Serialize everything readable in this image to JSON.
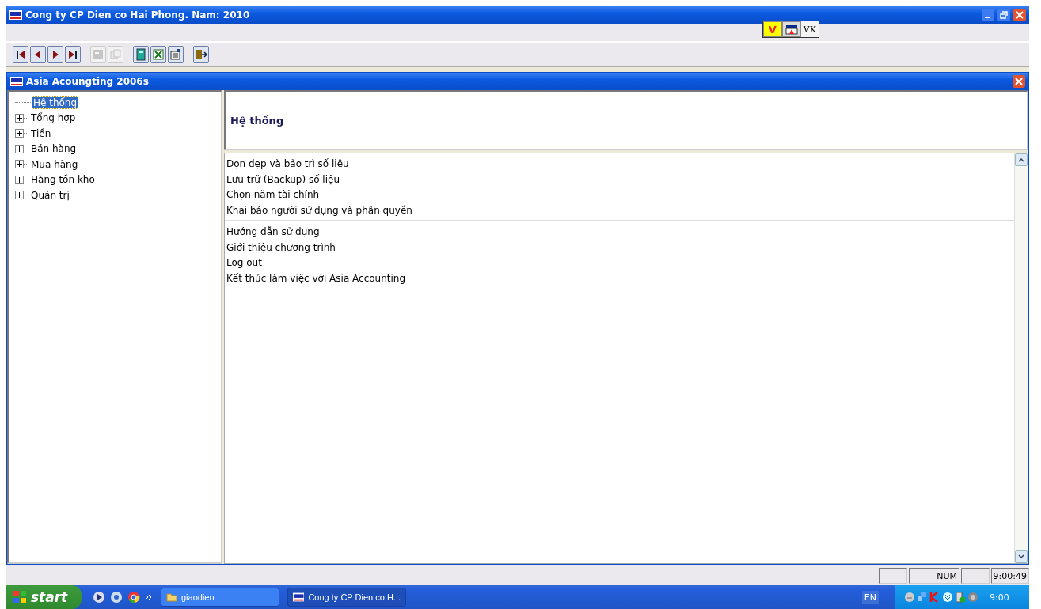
{
  "window": {
    "title": "Cong ty CP Dien co Hai Phong. Nam: 2010",
    "vk_label": "VK",
    "v_label": "V"
  },
  "toolbar": [
    {
      "kind": "first",
      "disabled": false
    },
    {
      "kind": "prev",
      "disabled": false
    },
    {
      "kind": "next",
      "disabled": false
    },
    {
      "kind": "last",
      "disabled": false
    },
    {
      "kind": "note",
      "disabled": true
    },
    {
      "kind": "copy",
      "disabled": true
    },
    {
      "kind": "calc",
      "disabled": false
    },
    {
      "kind": "excel",
      "disabled": false
    },
    {
      "kind": "form",
      "disabled": false
    },
    {
      "kind": "exit",
      "disabled": false
    }
  ],
  "child_window": {
    "title": "Asia Acoungting 2006s"
  },
  "tree": [
    {
      "label": "Hệ thống",
      "kind": "leaf",
      "selected": true
    },
    {
      "label": "Tổng hợp",
      "kind": "folder",
      "selected": false
    },
    {
      "label": "Tiền",
      "kind": "folder",
      "selected": false
    },
    {
      "label": "Bán hàng",
      "kind": "folder",
      "selected": false
    },
    {
      "label": "Mua hàng",
      "kind": "folder",
      "selected": false
    },
    {
      "label": "Hàng tồn kho",
      "kind": "folder",
      "selected": false
    },
    {
      "label": "Quản trị",
      "kind": "folder",
      "selected": false
    }
  ],
  "panel": {
    "heading": "Hệ thống",
    "groups": [
      [
        "Dọn dẹp và bảo trì số liệu",
        "Lưu trữ (Backup) số liệu",
        "Chọn năm tài chính",
        "Khai báo người sử dụng và phân quyền"
      ],
      [
        "Hướng dẫn sử dụng",
        "Giới thiệu chương trình",
        "Log out",
        "Kết thúc làm việc với Asia Accounting"
      ]
    ]
  },
  "status_bar": {
    "num": "NUM",
    "time": "9:00:49"
  },
  "taskbar": {
    "start": "start",
    "tasks": [
      {
        "label": "giaodien",
        "selected": false
      },
      {
        "label": "Cong ty CP Dien co H...",
        "selected": true
      }
    ],
    "language": "EN",
    "clock": "9:00"
  }
}
